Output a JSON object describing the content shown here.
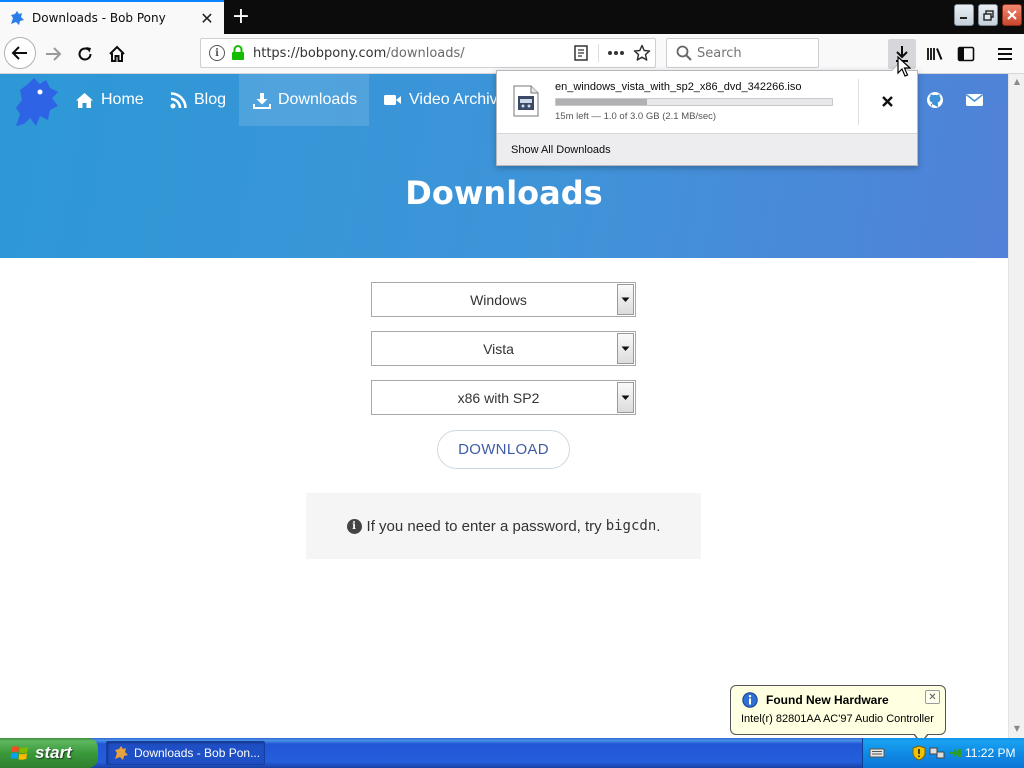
{
  "browser": {
    "tab_title": "Downloads - Bob Pony",
    "url_host": "https://bobpony.com",
    "url_path": "/downloads/",
    "search_placeholder": "Search"
  },
  "site_nav": {
    "items": [
      {
        "label": "Home",
        "icon": "home-icon"
      },
      {
        "label": "Blog",
        "icon": "rss-icon"
      },
      {
        "label": "Downloads",
        "icon": "download-icon"
      },
      {
        "label": "Video Archiv",
        "icon": "video-icon"
      }
    ],
    "right_icons": [
      "github-icon",
      "mail-icon"
    ]
  },
  "hero": {
    "title": "Downloads"
  },
  "form": {
    "os": "Windows",
    "version": "Vista",
    "edition": "x86 with SP2",
    "download_label": "DOWNLOAD"
  },
  "note": {
    "text": "If you need to enter a password, try",
    "code": "bigcdn",
    "end": "."
  },
  "downloads_panel": {
    "filename": "en_windows_vista_with_sp2_x86_dvd_342266.iso",
    "status": "15m left — 1.0 of 3.0 GB (2.1 MB/sec)",
    "progress": 0.33,
    "show_all_label": "Show All Downloads"
  },
  "balloon": {
    "title": "Found New Hardware",
    "text": "Intel(r) 82801AA AC'97 Audio Controller"
  },
  "taskbar": {
    "start_label": "start",
    "task_label": "Downloads - Bob Pon...",
    "clock": "11:22 PM"
  },
  "colors": {
    "hero_start": "#2d98d6",
    "hero_end": "#5181d8",
    "tab_accent": "#0a84ff",
    "download_button_text": "#3f5ca8",
    "taskbar_blue": "#245edb",
    "start_green": "#3a9a3a"
  }
}
